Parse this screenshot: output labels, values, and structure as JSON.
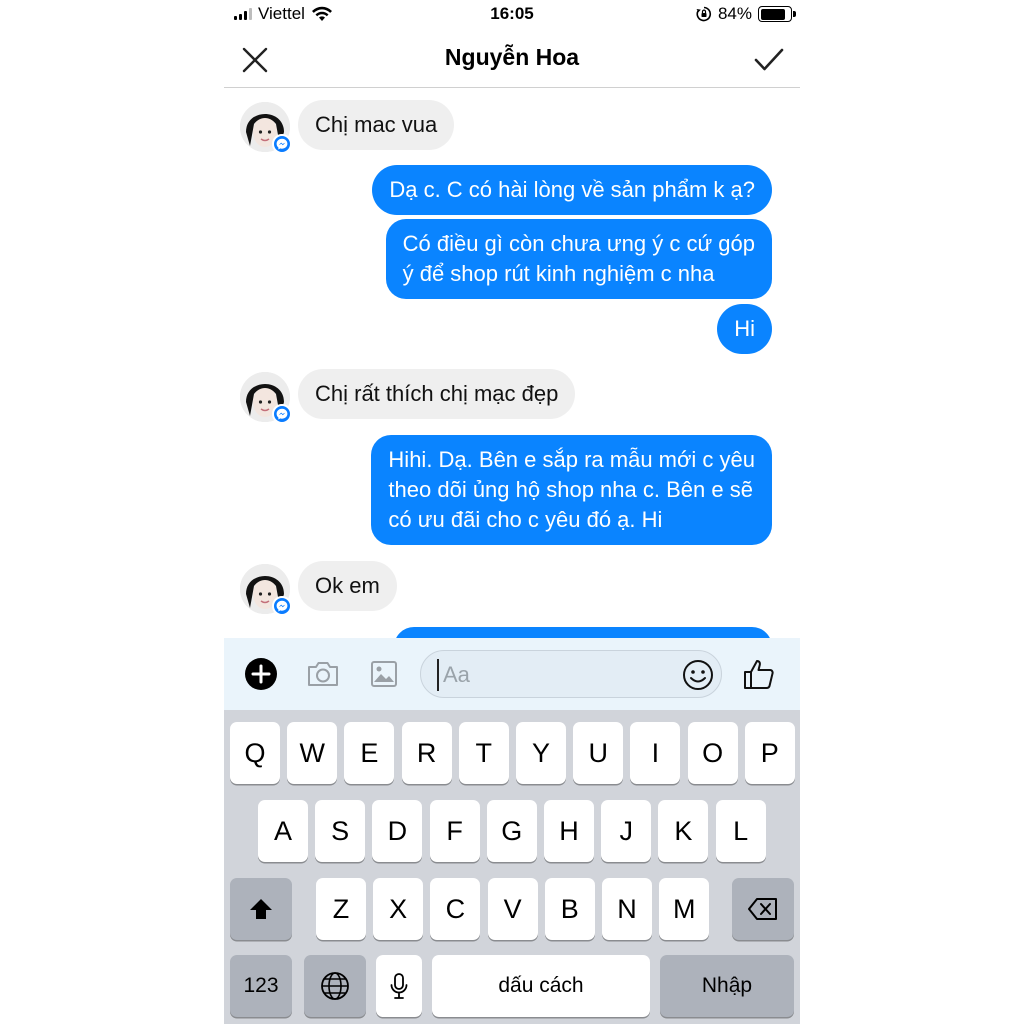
{
  "status_bar": {
    "carrier": "Viettel",
    "time": "16:05",
    "battery": "84%",
    "battery_level": 0.84
  },
  "header": {
    "title": "Nguyễn Hoa",
    "close_icon": "close-icon",
    "confirm_icon": "checkmark-icon"
  },
  "messages": [
    {
      "direction": "incoming",
      "text": "Chị mac vua"
    },
    {
      "direction": "outgoing",
      "text": "Dạ c. C có hài lòng về sản phẩm k ạ?"
    },
    {
      "direction": "outgoing",
      "lines": [
        "Có điều gì còn chưa ưng ý c cứ góp",
        "ý để shop rút kinh nghiệm c nha"
      ]
    },
    {
      "direction": "outgoing",
      "text": "Hi"
    },
    {
      "direction": "incoming",
      "text": "Chị rất thích chị mạc đẹp"
    },
    {
      "direction": "outgoing",
      "lines": [
        "Hihi. Dạ. Bên e sắp ra mẫu mới c yêu",
        "theo dõi ủng hộ shop nha c. Bên e sẽ",
        "có ưu đãi cho c yêu đó ạ. Hi"
      ]
    },
    {
      "direction": "incoming",
      "text": "Ok em"
    }
  ],
  "composer": {
    "placeholder": "Aa",
    "icons": [
      "plus-icon",
      "camera-icon",
      "gallery-icon",
      "emoji-icon",
      "thumbs-up-icon"
    ]
  },
  "keyboard": {
    "row1": [
      "Q",
      "W",
      "E",
      "R",
      "T",
      "Y",
      "U",
      "I",
      "O",
      "P"
    ],
    "row2": [
      "A",
      "S",
      "D",
      "F",
      "G",
      "H",
      "J",
      "K",
      "L"
    ],
    "row3": [
      "Z",
      "X",
      "C",
      "V",
      "B",
      "N",
      "M"
    ],
    "numbers_key": "123",
    "space_key": "dấu cách",
    "return_key": "Nhập",
    "colors": {
      "background": "#d1d4da",
      "key": "#ffffff",
      "special_key": "#adb2bb"
    }
  },
  "colors": {
    "outgoing_bubble": "#0a84ff",
    "incoming_bubble": "#efefef",
    "badge": "#0a7cff"
  }
}
